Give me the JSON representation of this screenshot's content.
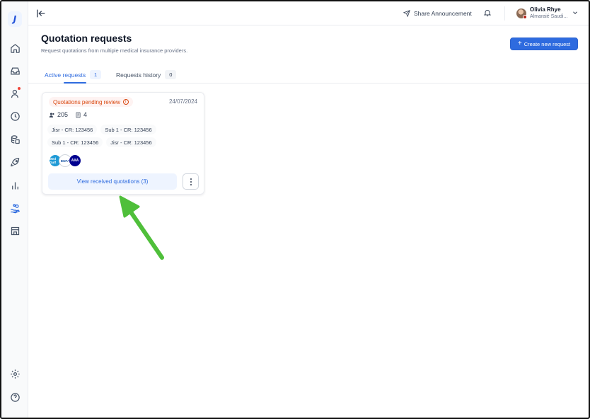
{
  "app": {
    "logo_letter": "J"
  },
  "sidebar": {
    "items": [
      {
        "icon": "home-icon"
      },
      {
        "icon": "inbox-icon"
      },
      {
        "icon": "user-icon",
        "has_notification": true
      },
      {
        "icon": "clock-icon"
      },
      {
        "icon": "database-icon"
      },
      {
        "icon": "rocket-icon"
      },
      {
        "icon": "bar-chart-icon"
      },
      {
        "icon": "hand-coins-icon",
        "active": true
      },
      {
        "icon": "store-icon"
      }
    ],
    "bottom": [
      {
        "icon": "settings-icon"
      },
      {
        "icon": "help-icon"
      }
    ]
  },
  "header": {
    "share_label": "Share Announcement",
    "user": {
      "name": "Olivia Rhye",
      "org": "Almaraié Saudi..."
    }
  },
  "page": {
    "title": "Quotation requests",
    "subtitle": "Request quotations from multiple medical insurance providers.",
    "create_label": "Create new request",
    "create_plus": "+"
  },
  "tabs": [
    {
      "label": "Active requests",
      "count": "1",
      "active": true
    },
    {
      "label": "Requests history",
      "count": "0",
      "active": false
    }
  ],
  "request_card": {
    "status": "Quotations pending review",
    "info_glyph": "i",
    "date": "24/07/2024",
    "members": "205",
    "documents": "4",
    "entities": [
      "Jisr - CR: 123456",
      "Sub 1 - CR: 123456",
      "Sub 1 - CR: 123456",
      "Jisr - CR: 123456"
    ],
    "insurer_logos": [
      {
        "text": "Med Gulf"
      },
      {
        "text": "BUPA"
      },
      {
        "text": "AXA"
      }
    ],
    "view_label": "View received quotations (3)"
  },
  "colors": {
    "accent": "#2e6bdf",
    "status_text": "#d9480f",
    "annotation_arrow": "#4fbf3a"
  }
}
